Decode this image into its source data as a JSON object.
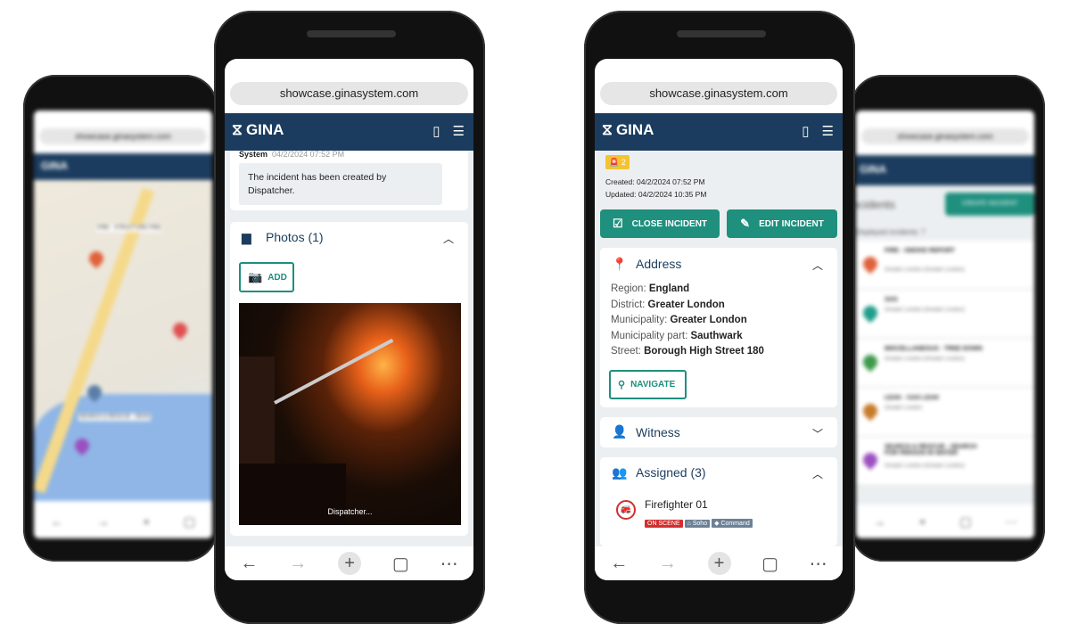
{
  "url": "showcase.ginasystem.com",
  "brand": "GINA",
  "colors": {
    "header": "#1b3c5e",
    "accent": "#1f8f7e",
    "on_scene": "#d32f2f",
    "badge": "#f4c430"
  },
  "left_bg_phone": {
    "map_labels": [
      "FIRE - STRUCTURE FIRE",
      "FIRE",
      "SEARCH & RESCUE - DEAD"
    ]
  },
  "left_phone": {
    "log": {
      "author": "System",
      "time": "04/2/2024 07:52 PM",
      "message": "The incident has been created by Dispatcher."
    },
    "photos": {
      "title": "Photos (1)",
      "add_label": "ADD",
      "caption": "Dispatcher..."
    }
  },
  "right_phone": {
    "badge_count": "2",
    "created": "Created: 04/2/2024 07:52 PM",
    "updated": "Updated: 04/2/2024 10:35 PM",
    "close_label": "CLOSE INCIDENT",
    "edit_label": "EDIT INCIDENT",
    "address": {
      "title": "Address",
      "rows": [
        {
          "label": "Region: ",
          "value": "England"
        },
        {
          "label": "District: ",
          "value": "Greater London"
        },
        {
          "label": "Municipality: ",
          "value": "Greater London"
        },
        {
          "label": "Municipality part: ",
          "value": "Sauthwark"
        },
        {
          "label": "Street: ",
          "value": "Borough High Street 180"
        }
      ],
      "navigate_label": "NAVIGATE"
    },
    "witness": {
      "title": "Witness"
    },
    "assigned": {
      "title": "Assigned (3)",
      "unit": "Firefighter 01",
      "tags": [
        "ON SCENE",
        "Soho",
        "Command"
      ]
    }
  },
  "right_bg_phone": {
    "title": "Incidents",
    "create_label": "CREATE INCIDENT",
    "filter_text": "Displayed incidents: 7",
    "items": [
      {
        "title": "FIRE - SMOKE REPORT",
        "sub": "Greater London (Greater London)",
        "color": "#e0623a"
      },
      {
        "title": "SOS",
        "sub": "Greater London (Greater London)",
        "color": "#1f9e8a"
      },
      {
        "title": "MISCELLANEOUS - TREE DOWN",
        "sub": "Greater London (Greater London)",
        "color": "#3c9a4a"
      },
      {
        "title": "LEAK - GAS LEAK",
        "sub": "Greater London",
        "color": "#c77a2a"
      },
      {
        "title": "SEARCH & RESCUE - SEARCH FOR PERSON IN WATER",
        "sub": "Greater London (Greater London)",
        "color": "#9b4fc0"
      }
    ]
  }
}
